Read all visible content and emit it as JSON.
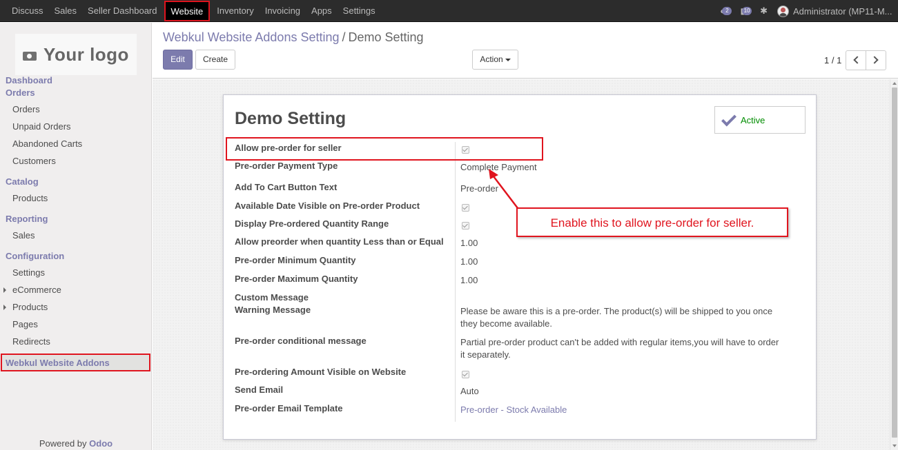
{
  "topbar": {
    "menu": [
      "Discuss",
      "Sales",
      "Seller Dashboard",
      "Website",
      "Inventory",
      "Invoicing",
      "Apps",
      "Settings"
    ],
    "active_menu": "Website",
    "chat_count": "2",
    "message_count": "10",
    "user": "Administrator (MP11-M..."
  },
  "sidebar": {
    "logo_text": "Your logo",
    "dashboard": "Dashboard",
    "orders_head": "Orders",
    "orders_items": [
      "Orders",
      "Unpaid Orders",
      "Abandoned Carts",
      "Customers"
    ],
    "catalog_head": "Catalog",
    "catalog_items": [
      "Products"
    ],
    "reporting_head": "Reporting",
    "reporting_items": [
      "Sales"
    ],
    "configuration_head": "Configuration",
    "configuration_items": [
      "Settings",
      "eCommerce",
      "Products",
      "Pages",
      "Redirects"
    ],
    "selected": "Webkul Website Addons",
    "powered_prefix": "Powered by",
    "powered_brand": "Odoo"
  },
  "control_panel": {
    "breadcrumb_parent": "Webkul Website Addons Setting",
    "breadcrumb_sep": "/",
    "breadcrumb_current": "Demo Setting",
    "edit_label": "Edit",
    "create_label": "Create",
    "action_label": "Action",
    "pager": "1 / 1"
  },
  "form": {
    "title": "Demo Setting",
    "status_label": "Active",
    "fields": {
      "allow_preorder_seller": {
        "label": "Allow pre-order for seller",
        "checked": true
      },
      "payment_type": {
        "label": "Pre-order Payment Type",
        "value": "Complete Payment"
      },
      "cart_button_text": {
        "label": "Add To Cart Button Text",
        "value": "Pre-order"
      },
      "available_date_visible": {
        "label": "Available Date Visible on Pre-order Product",
        "checked": true
      },
      "quantity_range": {
        "label": "Display Pre-ordered Quantity Range",
        "checked": true
      },
      "less_than_equal": {
        "label": "Allow preorder when quantity Less than or Equal",
        "value": "1.00"
      },
      "min_qty": {
        "label": "Pre-order Minimum Quantity",
        "value": "1.00"
      },
      "max_qty": {
        "label": "Pre-order Maximum Quantity",
        "value": "1.00"
      },
      "custom_message": {
        "label": "Custom Message"
      },
      "warning_message": {
        "label": "Warning Message",
        "value": "Please be aware this is a pre-order. The product(s) will be shipped to you once they become available."
      },
      "conditional_message": {
        "label": "Pre-order conditional message",
        "value": "Partial pre-order product can't be added with regular items,you will have to order it separately."
      },
      "amount_visible": {
        "label": "Pre-ordering Amount Visible on Website",
        "checked": true
      },
      "send_email": {
        "label": "Send Email",
        "value": "Auto"
      },
      "email_template": {
        "label": "Pre-order Email Template",
        "value": "Pre-order - Stock Available"
      }
    }
  },
  "annotation": {
    "callout_text": "Enable this to allow pre-order for seller."
  },
  "colors": {
    "brand": "#7c7bad",
    "annotation": "#e0141e",
    "active_status": "#008c00"
  }
}
